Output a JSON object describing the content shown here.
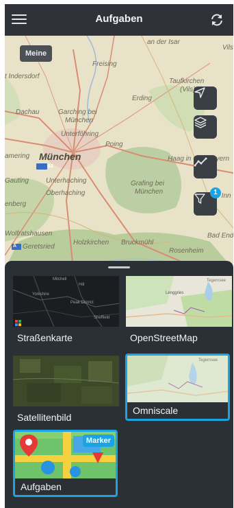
{
  "header": {
    "title": "Aufgaben",
    "menu_icon": "hamburger-menu-icon",
    "sync_icon": "sync-icon"
  },
  "map": {
    "meine_label": "Meine",
    "place_labels": [
      "Freising",
      "an der Isar",
      "Vils",
      "t Indersdorf",
      "Taufkirchen",
      "(Vils)",
      "Erding",
      "Dachau",
      "Garching bei",
      "München",
      "Unterföhring",
      "Poing",
      "München",
      "Haag in Oberbayern",
      "amering",
      "Gauting",
      "Unterhaching",
      "Oberhaching",
      "Grafing bei",
      "München",
      "am Inn",
      "enberg",
      "Wolfratshausen",
      "Geretsried",
      "Holzkirchen",
      "Bruckmühl",
      "Bad End",
      "Rosenheim"
    ],
    "road_shields": [
      "B2",
      "A"
    ],
    "buttons": [
      {
        "name": "locate-button",
        "icon": "navigation-arrow-icon"
      },
      {
        "name": "layers-button",
        "icon": "layers-icon"
      },
      {
        "name": "track-button",
        "icon": "route-line-icon"
      },
      {
        "name": "filter-button",
        "icon": "filter-icon",
        "badge": "1"
      }
    ]
  },
  "layers_sheet": {
    "tiles": [
      {
        "label": "Straßenkarte",
        "selected": false
      },
      {
        "label": "OpenStreetMap",
        "selected": false
      },
      {
        "label": "Satellitenbild",
        "selected": false
      },
      {
        "label": "Omniscale",
        "selected": true
      },
      {
        "label": "Aufgaben",
        "selected": true,
        "tag": "Marker"
      }
    ],
    "thumb_text": {
      "street": [
        "Mitchell",
        "Hill",
        "Yorkshire",
        "Peak District",
        "Sheffield"
      ],
      "osm": [
        "Tegernsee",
        "Lenggries"
      ],
      "omni": [
        "Tegernsee"
      ]
    }
  },
  "colors": {
    "accent": "#1ba3e4",
    "background": "#2b2f36",
    "map_base": "#e7e2c6"
  }
}
